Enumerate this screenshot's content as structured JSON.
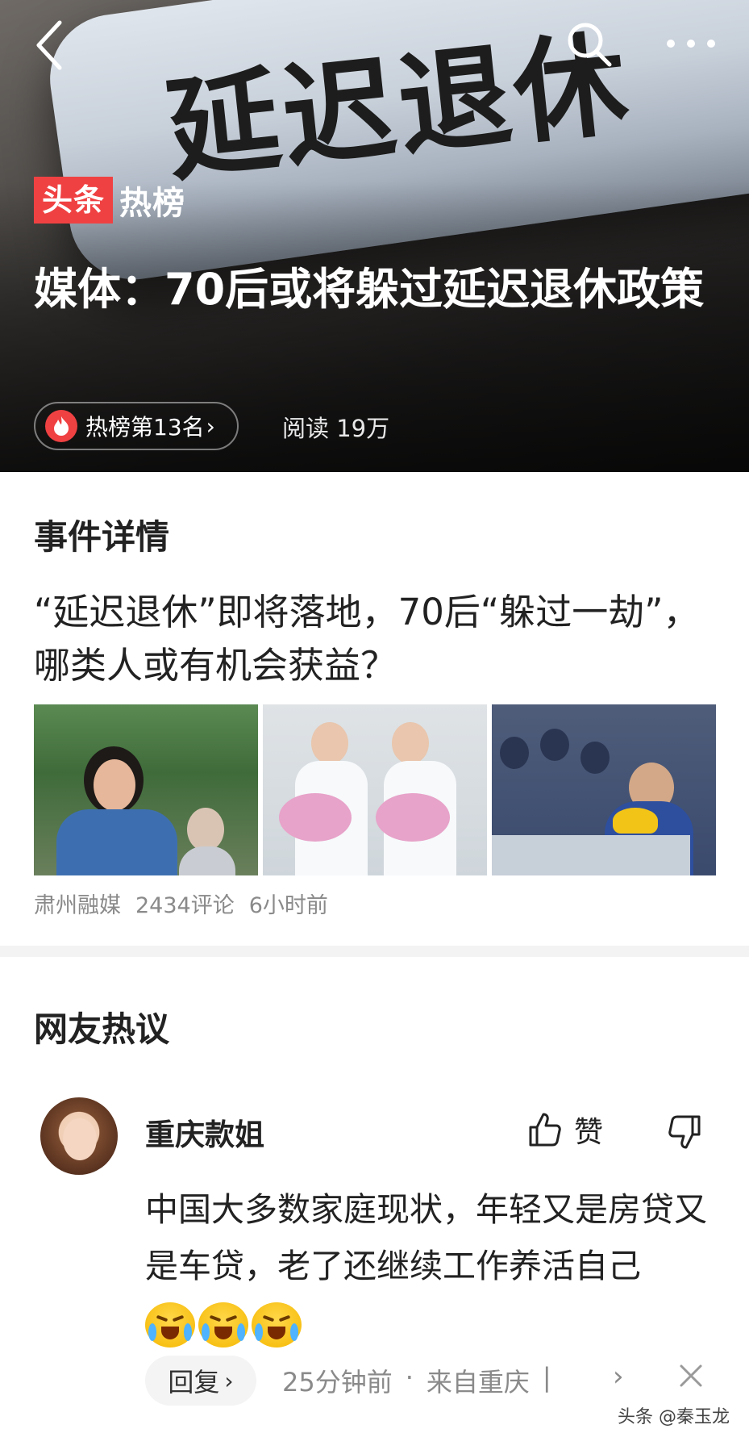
{
  "hero": {
    "image_text": "延迟退休",
    "brand_badge": "头条",
    "brand_label": "热榜",
    "title": "媒体：70后或将躲过延迟退休政策",
    "rank_label": "热榜第13名",
    "rank_chevron": "›",
    "reads": "阅读 19万"
  },
  "event": {
    "section_title": "事件详情",
    "headline": "“延迟退休”即将落地，70后“躲过一劫”，哪类人或有机会获益？",
    "source": "肃州融媒",
    "comments": "2434评论",
    "time": "6小时前"
  },
  "discussion": {
    "section_title": "网友热议",
    "comment": {
      "username": "重庆款姐",
      "like_label": "赞",
      "text": "中国大多数家庭现状，年轻又是房贷又是车贷，老了还继续工作养活自己",
      "reply_label": "回复",
      "reply_chevron": "›",
      "time": "25分钟前",
      "sep": "·",
      "location": "来自重庆",
      "bar": "|",
      "more_chevron": "›"
    }
  },
  "watermark": "头条 @秦玉龙",
  "colors": {
    "accent": "#f04142",
    "muted": "#8a8a8a"
  },
  "icons": [
    "back-icon",
    "search-icon",
    "more-icon",
    "fire-icon",
    "thumbs-up-icon",
    "thumbs-down-icon",
    "close-icon",
    "crying-emoji"
  ]
}
